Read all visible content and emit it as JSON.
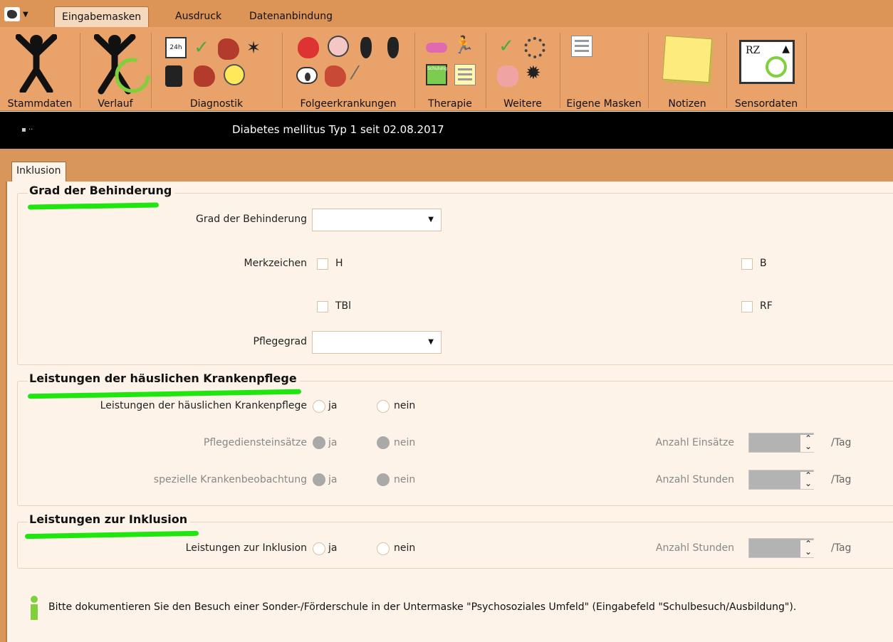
{
  "ribbon_tabs": [
    "Eingabemasken",
    "Ausdruck",
    "Datenanbindung"
  ],
  "ribbon_groups": {
    "stammdaten": "Stammdaten",
    "verlauf": "Verlauf",
    "diagnostik": "Diagnostik",
    "folgeerkrankungen": "Folgeerkrankungen",
    "therapie": "Therapie",
    "weitere": "Weitere",
    "eigene_masken": "Eigene Masken",
    "notizen": "Notizen",
    "sensordaten": "Sensordaten"
  },
  "icon_texts": {
    "h24": "24h",
    "schulung": "Schulung",
    "rz": "RZ"
  },
  "infobar": {
    "diagnosis": "Diabetes mellitus Typ 1 seit 02.08.2017"
  },
  "subtab": "Inklusion",
  "sections": {
    "grad": {
      "title": "Grad der Behinderung",
      "grad_label": "Grad der Behinderung",
      "grad_value": "",
      "merkzeichen_label": "Merkzeichen",
      "cb_h": "H",
      "cb_b": "B",
      "cb_tbl": "TBl",
      "cb_rf": "RF",
      "pflegegrad_label": "Pflegegrad",
      "pflegegrad_value": ""
    },
    "kranken": {
      "title": "Leistungen der häuslichen Krankenpflege",
      "q1": "Leistungen der häuslichen Krankenpflege",
      "q2": "Pflegediensteinsätze",
      "q3": "spezielle Krankenbeobachtung",
      "ja": "ja",
      "nein": "nein",
      "anzahl_einsaetze": "Anzahl Einsätze",
      "anzahl_stunden": "Anzahl Stunden",
      "unit": "/Tag"
    },
    "inklusion": {
      "title": "Leistungen zur Inklusion",
      "q1": "Leistungen zur Inklusion",
      "ja": "ja",
      "nein": "nein",
      "anzahl_stunden": "Anzahl Stunden",
      "unit": "/Tag"
    }
  },
  "hint": "Bitte dokumentieren Sie den Besuch einer Sonder-/Förderschule in der Untermaske \"Psychosoziales Umfeld\" (Eingabefeld \"Schulbesuch/Ausbildung\").",
  "colors": {
    "accent": "#dc9457",
    "ribbon": "#e8a26a",
    "panel": "#fdf3e8",
    "highlight": "#1ee60e"
  }
}
